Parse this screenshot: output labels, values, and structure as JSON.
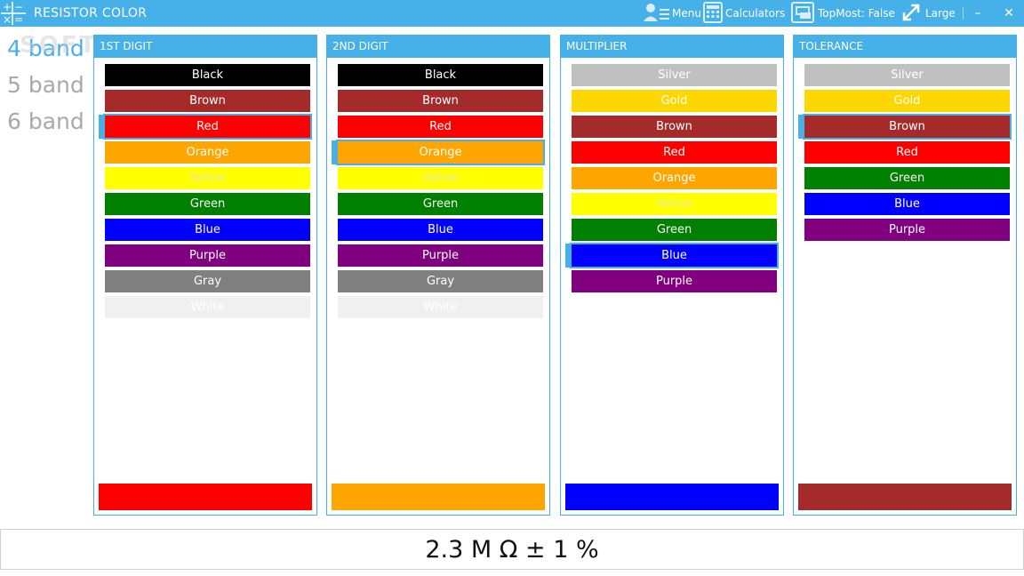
{
  "app": {
    "title": "RESISTOR COLOR",
    "icon": "calculator-app-icon"
  },
  "toolbar": {
    "menu": {
      "label": "Menu",
      "icon": "menu-icon"
    },
    "calculators": {
      "label": "Calculators",
      "icon": "calculator-icon"
    },
    "topmost": {
      "label": "TopMost: False",
      "icon": "window-pin-icon"
    },
    "size": {
      "label": "Large",
      "icon": "resize-icon"
    },
    "minimize": "–",
    "close": "✕"
  },
  "bands": {
    "items": [
      "4 band",
      "5 band",
      "6 band"
    ],
    "active": 0
  },
  "watermark": "SOFTPEDIA",
  "colors": {
    "Black": "#000000",
    "Brown": "#a52a2a",
    "Red": "#ff0000",
    "Orange": "#ffa500",
    "Yellow": "#ffff00",
    "Green": "#008000",
    "Blue": "#0000ff",
    "Purple": "#800080",
    "Gray": "#808080",
    "White": "#f0f0f0",
    "Silver": "#c0c0c0",
    "Gold": "#ffd700"
  },
  "panels": [
    {
      "title": "1ST DIGIT",
      "items": [
        "Black",
        "Brown",
        "Red",
        "Orange",
        "Yellow",
        "Green",
        "Blue",
        "Purple",
        "Gray",
        "White"
      ],
      "selected": "Red"
    },
    {
      "title": "2ND DIGIT",
      "items": [
        "Black",
        "Brown",
        "Red",
        "Orange",
        "Yellow",
        "Green",
        "Blue",
        "Purple",
        "Gray",
        "White"
      ],
      "selected": "Orange"
    },
    {
      "title": "MULTIPLIER",
      "items": [
        "Silver",
        "Gold",
        "Brown",
        "Red",
        "Orange",
        "Yellow",
        "Green",
        "Blue",
        "Purple"
      ],
      "selected": "Blue"
    },
    {
      "title": "TOLERANCE",
      "items": [
        "Silver",
        "Gold",
        "Brown",
        "Red",
        "Green",
        "Blue",
        "Purple"
      ],
      "selected": "Brown"
    }
  ],
  "result": "2.3 M Ω ± 1 %"
}
